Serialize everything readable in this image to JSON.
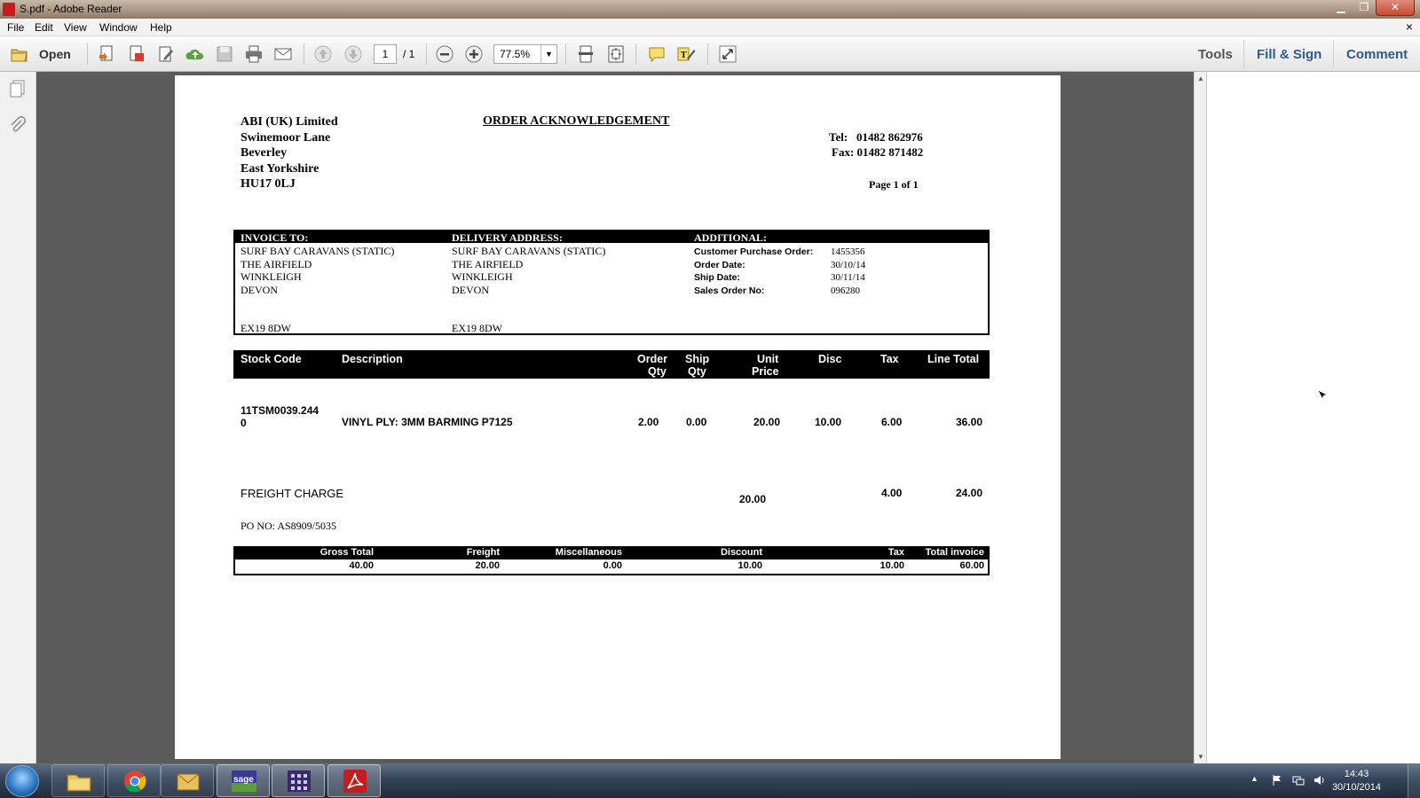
{
  "window": {
    "title": "S.pdf - Adobe Reader",
    "minimize_glyph": "▁",
    "maximize_glyph": "❐",
    "close_glyph": "✕",
    "doc_close_glyph": "×"
  },
  "menu": [
    "File",
    "Edit",
    "View",
    "Window",
    "Help"
  ],
  "toolbar": {
    "open_label": "Open",
    "page_current": "1",
    "page_total": "/ 1",
    "zoom": "77.5%",
    "zoom_dropdown": "▼",
    "tools_label": "Tools",
    "fill_sign_label": "Fill & Sign",
    "comment_label": "Comment"
  },
  "scrollbar": {
    "up": "▲",
    "down": "▼"
  },
  "document": {
    "company": {
      "name": "ABI (UK) Limited",
      "address": [
        "Swinemoor Lane",
        "Beverley",
        "East Yorkshire",
        "HU17 0LJ"
      ]
    },
    "doc_title": "ORDER ACKNOWLEDGEMENT",
    "tel": "Tel:   01482 862976",
    "fax": "Fax: 01482 871482",
    "page_label": "Page 1 of 1",
    "invoice_to": {
      "header": "INVOICE TO:",
      "lines": [
        "SURF BAY CARAVANS (STATIC)",
        "THE AIRFIELD",
        "WINKLEIGH",
        "DEVON"
      ],
      "postcode": "EX19 8DW"
    },
    "delivery": {
      "header": "DELIVERY ADDRESS:",
      "lines": [
        "SURF BAY CARAVANS (STATIC)",
        "THE AIRFIELD",
        "WINKLEIGH",
        "DEVON"
      ],
      "postcode": "EX19 8DW"
    },
    "additional": {
      "header": "ADDITIONAL:",
      "rows": [
        {
          "label": "Customer Purchase Order:",
          "value": "1455356"
        },
        {
          "label": "Order Date:",
          "value": "30/10/14"
        },
        {
          "label": "Ship Date:",
          "value": "30/11/14"
        },
        {
          "label": "Sales Order No:",
          "value": "096280"
        }
      ]
    },
    "line_headers": {
      "stock_code": "Stock Code",
      "description": "Description",
      "order_qty_1": "Order",
      "order_qty_2": "Qty",
      "ship_qty_1": "Ship",
      "ship_qty_2": "Qty",
      "unit_price_1": "Unit",
      "unit_price_2": "Price",
      "disc": "Disc",
      "tax": "Tax",
      "line_total": "Line Total"
    },
    "line_item": {
      "stock_code_1": "11TSM0039.244",
      "stock_code_2": "0",
      "description": "VINYL PLY: 3MM BARMING P7125",
      "order_qty": "2.00",
      "ship_qty": "0.00",
      "unit_price": "20.00",
      "disc": "10.00",
      "tax": "6.00",
      "line_total": "36.00"
    },
    "freight": {
      "label": "FREIGHT CHARGE",
      "unit_price": "20.00",
      "tax": "4.00",
      "line_total": "24.00"
    },
    "po_no": "PO NO: AS8909/5035",
    "totals": {
      "headers": {
        "gross": "Gross Total",
        "freight": "Freight",
        "misc": "Miscellaneous",
        "discount": "Discount",
        "tax": "Tax",
        "total": "Total invoice"
      },
      "values": {
        "gross": "40.00",
        "freight": "20.00",
        "misc": "0.00",
        "discount": "10.00",
        "tax": "10.00",
        "total": "60.00"
      }
    }
  },
  "taskbar": {
    "apps": [
      "windows-explorer",
      "chrome",
      "outlook",
      "sage",
      "calculator",
      "adobe-reader"
    ],
    "clock_time": "14:43",
    "clock_date": "30/10/2014",
    "tray_arrow": "▲"
  }
}
